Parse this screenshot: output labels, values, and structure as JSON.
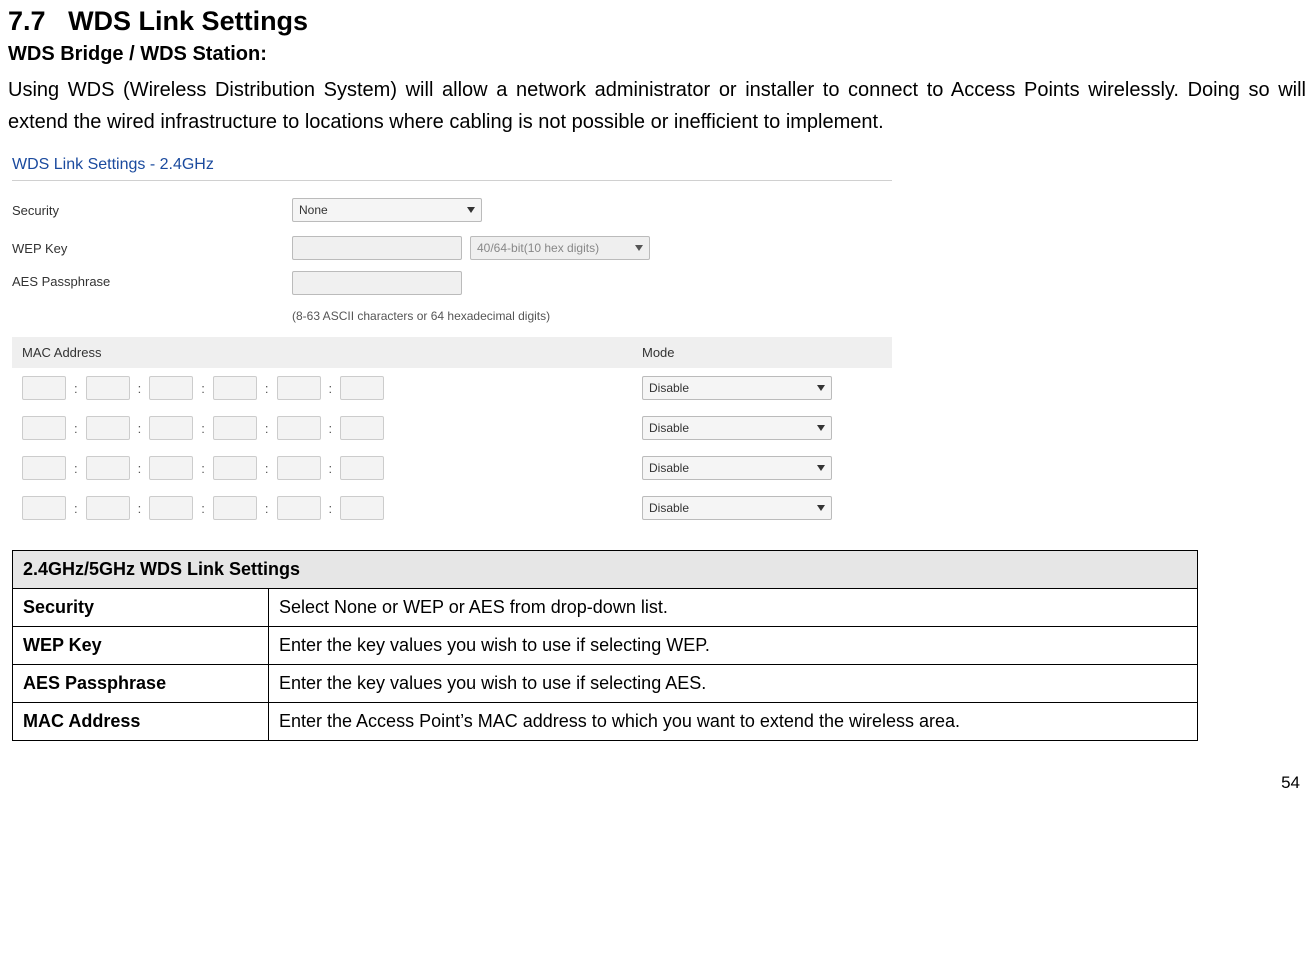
{
  "page": {
    "section_number": "7.7",
    "section_title": "WDS Link Settings",
    "subtitle": "WDS Bridge / WDS Station:",
    "paragraph": "Using WDS (Wireless Distribution System) will allow a network administrator or installer to connect to Access Points wirelessly. Doing so will extend the wired infrastructure to locations where cabling is not possible or inefficient to implement.",
    "page_number": "54"
  },
  "panel": {
    "title": "WDS Link Settings - 2.4GHz",
    "rows": {
      "security_label": "Security",
      "security_value": "None",
      "wep_label": "WEP Key",
      "wep_bits_value": "40/64-bit(10 hex digits)",
      "aes_label": "AES Passphrase",
      "aes_hint": "(8-63 ASCII characters or 64 hexadecimal digits)"
    },
    "mac_header": {
      "c1": "MAC Address",
      "c2": "Mode"
    },
    "mode_value": "Disable",
    "mac_rows": 4,
    "octets": 6
  },
  "settings_table": {
    "header": "2.4GHz/5GHz WDS Link Settings",
    "rows": [
      {
        "k": "Security",
        "v": "Select None or WEP or AES from drop-down list."
      },
      {
        "k": "WEP Key",
        "v": "Enter the key values you wish to use if selecting WEP."
      },
      {
        "k": "AES Passphrase",
        "v": "Enter the key values you wish to use if selecting AES."
      },
      {
        "k": "MAC Address",
        "v": "Enter the Access Point’s MAC address to which you want to extend the wireless area."
      }
    ]
  }
}
